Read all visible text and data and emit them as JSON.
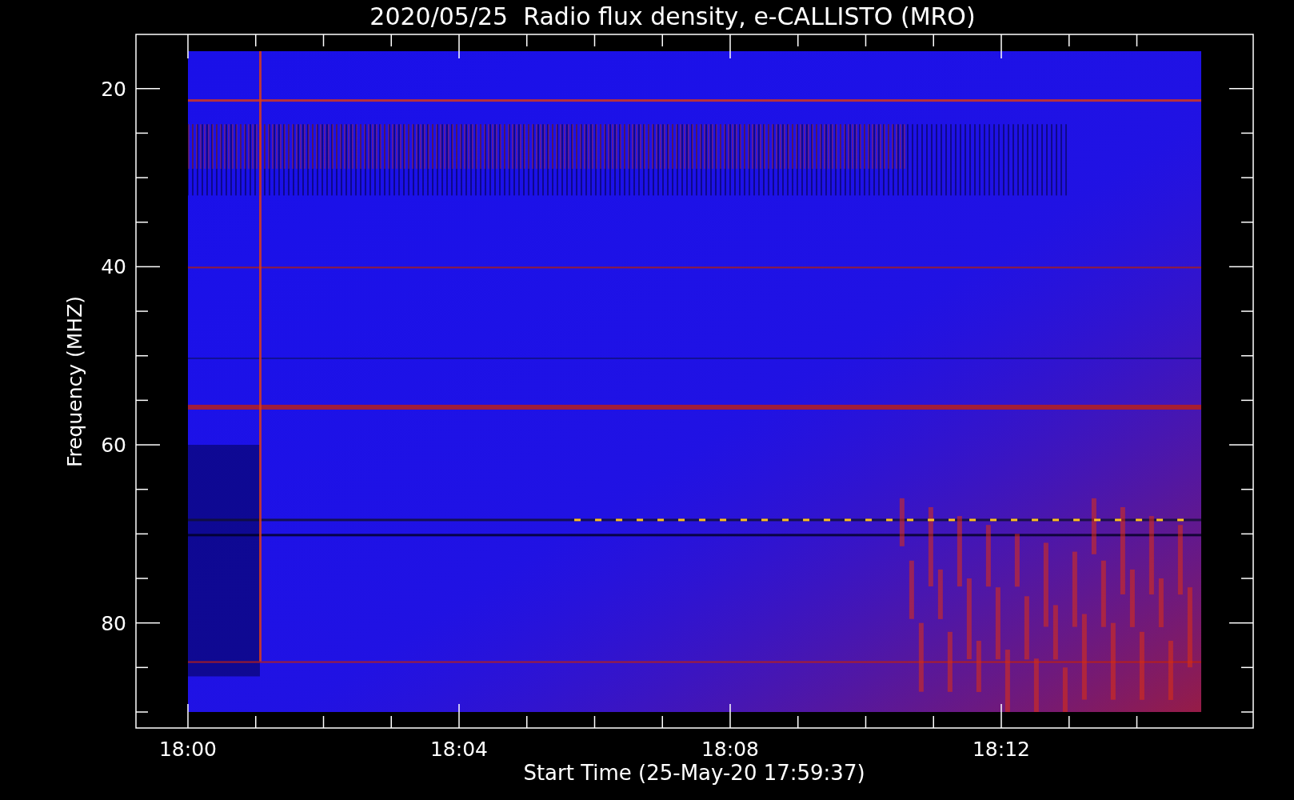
{
  "title": "2020/05/25  Radio flux density, e-CALLISTO (MRO)",
  "xlabel": "Start Time (25-May-20 17:59:37)",
  "ylabel": "Frequency (MHZ)",
  "yticks": [
    "20",
    "40",
    "60",
    "80"
  ],
  "xticks": [
    "18:00",
    "18:04",
    "18:08",
    "18:12"
  ]
}
